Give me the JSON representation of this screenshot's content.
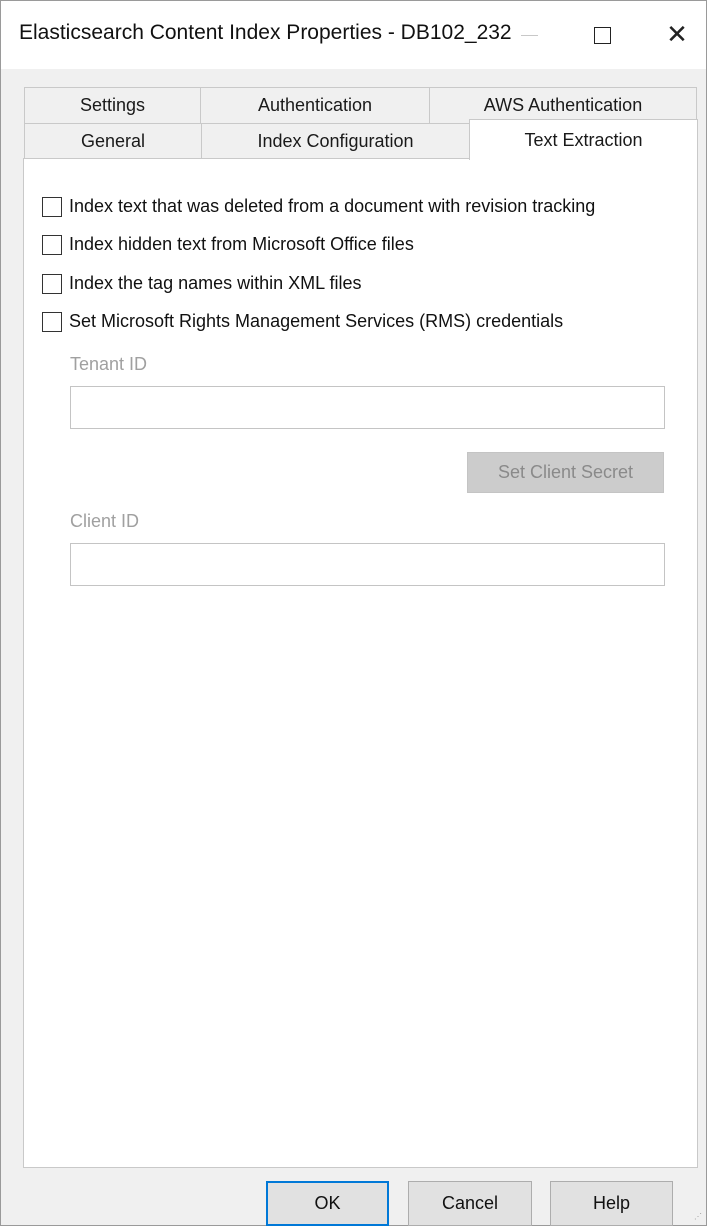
{
  "window": {
    "title": "Elasticsearch Content Index Properties - DB102_232"
  },
  "tabs": {
    "row1": [
      {
        "label": "Settings"
      },
      {
        "label": "Authentication"
      },
      {
        "label": "AWS Authentication"
      }
    ],
    "row2": [
      {
        "label": "General"
      },
      {
        "label": "Index Configuration"
      },
      {
        "label": "Text Extraction",
        "active": true
      }
    ]
  },
  "text_extraction": {
    "options": [
      {
        "label": "Index text that was deleted from a document with revision tracking",
        "checked": false
      },
      {
        "label": "Index hidden text from Microsoft Office files",
        "checked": false
      },
      {
        "label": "Index the tag names within XML files",
        "checked": false
      },
      {
        "label": "Set Microsoft Rights Management Services (RMS) credentials",
        "checked": false
      }
    ],
    "tenant_id": {
      "label": "Tenant ID",
      "value": ""
    },
    "set_client_secret_label": "Set Client Secret",
    "client_id": {
      "label": "Client ID",
      "value": ""
    }
  },
  "buttons": {
    "ok": "OK",
    "cancel": "Cancel",
    "help": "Help"
  },
  "colors": {
    "focus_border": "#0078d7",
    "disabled_text": "#a0a0a0"
  }
}
